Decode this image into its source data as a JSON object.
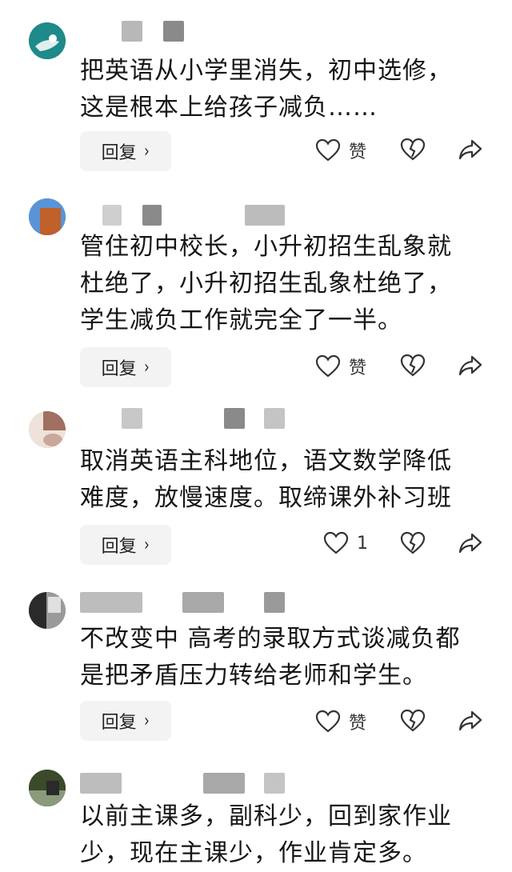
{
  "ui": {
    "reply_label": "回复",
    "reply_chevron": "›"
  },
  "comments": [
    {
      "text": "把英语从小学里消失，初中选修，\n这是根本上给孩子减负……",
      "like_label": "赞",
      "avatar_colors": [
        "#1f8a8a",
        "#d8e8ea"
      ]
    },
    {
      "text": "管住初中校长，小升初招生乱象就\n杜绝了，小升初招生乱象杜绝了，\n学生减负工作就完全了一半。",
      "like_label": "赞",
      "avatar_colors": [
        "#3b7fd0",
        "#c0602a"
      ]
    },
    {
      "text": "取消英语主科地位，语文数学降低\n难度，放慢速度。取缔课外补习班",
      "like_label": "1",
      "avatar_colors": [
        "#a07060",
        "#e8d8d0"
      ]
    },
    {
      "text": "不改变中 高考的录取方式谈减负都\n是把矛盾压力转给老师和学生。",
      "like_label": "赞",
      "avatar_colors": [
        "#2a2a2a",
        "#b0b0b0"
      ]
    },
    {
      "text": "以前主课多，副科少，回到家作业\n少，现在主课少，作业肯定多。",
      "like_label": "",
      "avatar_colors": [
        "#3a4a2a",
        "#8a9a7a"
      ]
    }
  ]
}
